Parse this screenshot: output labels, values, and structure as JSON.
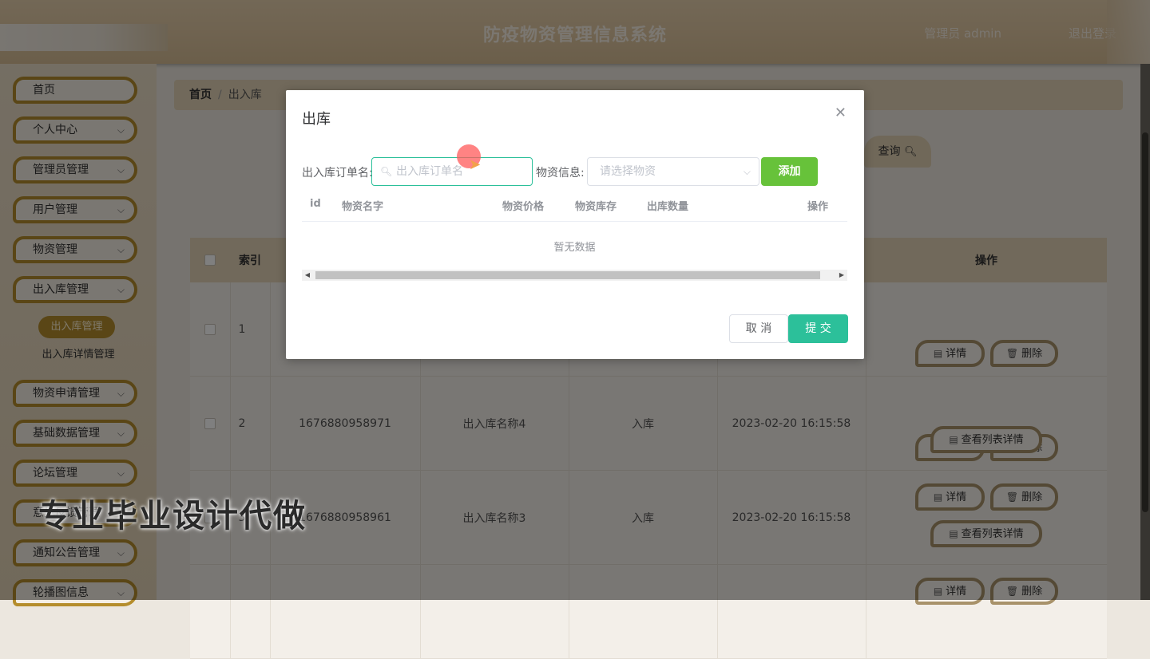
{
  "header": {
    "system_title": "防疫物资管理信息系统",
    "admin_label": "管理员 admin",
    "logout_label": "退出登录"
  },
  "sidebar": {
    "items": [
      {
        "label": "首页",
        "has_chevron": false
      },
      {
        "label": "个人中心",
        "has_chevron": true
      },
      {
        "label": "管理员管理",
        "has_chevron": true
      },
      {
        "label": "用户管理",
        "has_chevron": true
      },
      {
        "label": "物资管理",
        "has_chevron": true
      },
      {
        "label": "出入库管理",
        "has_chevron": true
      },
      {
        "label": "物资申请管理",
        "has_chevron": true
      },
      {
        "label": "基础数据管理",
        "has_chevron": true
      },
      {
        "label": "论坛管理",
        "has_chevron": true
      },
      {
        "label": "意见反馈管理",
        "has_chevron": true
      },
      {
        "label": "通知公告管理",
        "has_chevron": true
      },
      {
        "label": "轮播图信息",
        "has_chevron": true
      }
    ],
    "sub_items": [
      "出入库管理",
      "出入库详情管理"
    ]
  },
  "breadcrumb": {
    "home": "首页",
    "separator": "/",
    "current": "出入库"
  },
  "toolbar": {
    "query_label": "查询"
  },
  "table": {
    "headers": {
      "index": "索引",
      "actions": "操作"
    },
    "rows": [
      {
        "index": "1",
        "code": "",
        "name": "",
        "type": "",
        "time": ""
      },
      {
        "index": "2",
        "code": "1676880958971",
        "name": "出入库名称4",
        "type": "入库",
        "time": "2023-02-20 16:15:58"
      },
      {
        "index": "3",
        "code": "1676880958961",
        "name": "出入库名称3",
        "type": "入库",
        "time": "2023-02-20 16:15:58"
      }
    ],
    "actions": {
      "detail": "详情",
      "delete": "删除",
      "list_detail": "查看列表详情"
    }
  },
  "dialog": {
    "title": "出库",
    "order_name_label": "出入库订单名:",
    "order_name_placeholder": "出入库订单名",
    "goods_label": "物资信息:",
    "goods_placeholder": "请选择物资",
    "add_label": "添加",
    "columns": [
      "id",
      "物资名字",
      "物资价格",
      "物资库存",
      "出库数量",
      "操作"
    ],
    "empty_text": "暂无数据",
    "cancel_label": "取 消",
    "submit_label": "提 交"
  },
  "watermark": "专业毕业设计代做",
  "colors": {
    "accent_green": "#2cc09a",
    "add_green": "#67c23a",
    "menu_border": "#b58d2c",
    "header_bg": "#dfc6a0"
  },
  "icons": {
    "search": "search-icon",
    "close": "close-icon",
    "chevron": "chevron-down-icon",
    "detail": "document-icon",
    "delete": "trash-icon"
  }
}
